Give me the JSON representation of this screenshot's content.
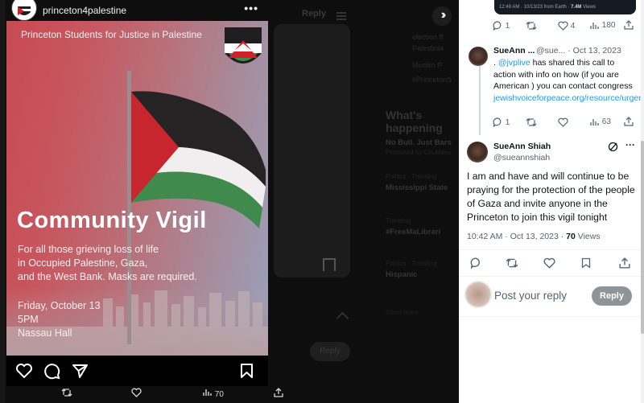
{
  "instagram": {
    "handle": "princeton4palestine",
    "more_label": "•••",
    "org_name": "Princeton Students for Justice in  Palestine",
    "title": "Community Vigil",
    "description_lines": [
      "For all those grieving loss of life",
      "in Occupied Palestine, Gaza,",
      "and the West Bank. Masks are required."
    ],
    "event_lines": [
      "Friday, October 13",
      "5PM",
      "Nassau Hall"
    ],
    "icons": [
      "heart-icon",
      "comment-icon",
      "share-icon",
      "bookmark-icon"
    ]
  },
  "backdrop": {
    "reply_label": "Reply",
    "whats_happening": "What's happening",
    "side_lines": [
      "election ff",
      "Palestinia",
      "Muslim P",
      "#PrincetonS"
    ],
    "trends": [
      {
        "title": "No Bull. Just Bars",
        "sub": "Promoted by Chubbies"
      },
      {
        "title": "Mississippi State",
        "sub": "Politics · Trending"
      },
      {
        "title": "#FreeMaLibrari",
        "sub": "Trending"
      },
      {
        "title": "Hispanic",
        "sub": "Politics · Trending"
      }
    ],
    "show_more": "Show more",
    "reply_button": "Reply",
    "action_bar": {
      "views": "70"
    }
  },
  "thread": {
    "embed_caption_prefix": "12:49 AM · 10/13/23 from Earth ·",
    "embed_views": "7.4M",
    "embed_caption_suffix": "Views",
    "top_stats": {
      "replies": "1",
      "likes": "4",
      "views": "180"
    },
    "reply_tweet": {
      "name": "SueAnn ...",
      "handle_date": "@sue... · Oct 13, 2023",
      "prefix": ". ",
      "mention": "@jvplive",
      "text": " has shared this call to action with info on how (if you are American ) you can contact congress ",
      "link": "jewishvoiceforpeace.org/resource/urgen..."
    },
    "reply_stats": {
      "replies": "1",
      "views": "63"
    },
    "main_tweet": {
      "name": "SueAnn Shiah",
      "handle": "@sueannshiah",
      "text": "I am and have and will continue to be praying for the protection of the people of Gaza and invite anyone in the Princeton to join this vigil tonight",
      "time_date": "10:42 AM · Oct 13, 2023 ·",
      "views_count": "70",
      "views_label": "Views"
    },
    "reply_box": {
      "placeholder": "Post your reply",
      "button": "Reply"
    }
  },
  "colors": {
    "x_link": "#1d9bf0",
    "x_text": "#0f1419",
    "x_muted": "#536471",
    "reply_button": "#8f9597",
    "poster_red": "#c84a52",
    "flag_green": "#3f8a4c"
  }
}
